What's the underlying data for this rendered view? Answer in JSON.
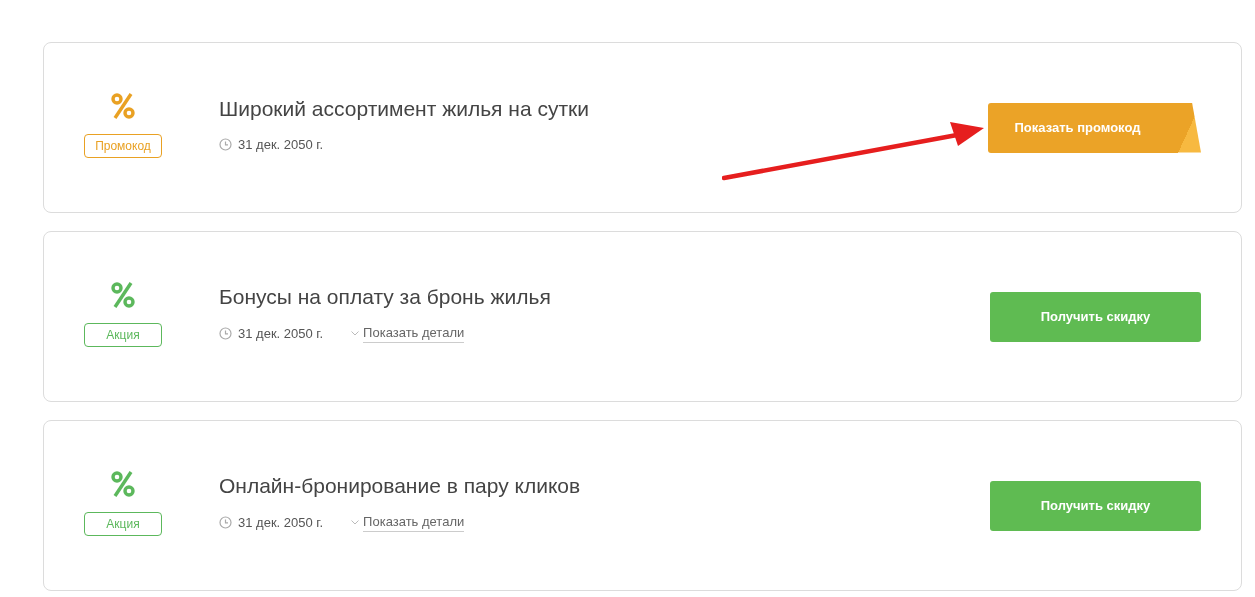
{
  "offers": [
    {
      "kind": "promo",
      "badge": "Промокод",
      "title": "Широкий ассортимент жилья на сутки",
      "date": "31 дек. 2050 г.",
      "button": "Показать промокод"
    },
    {
      "kind": "deal",
      "badge": "Акция",
      "title": "Бонусы на оплату за бронь жилья",
      "date": "31 дек. 2050 г.",
      "details": "Показать детали",
      "button": "Получить скидку"
    },
    {
      "kind": "deal",
      "badge": "Акция",
      "title": "Онлайн-бронирование в пару кликов",
      "date": "31 дек. 2050 г.",
      "details": "Показать детали",
      "button": "Получить скидку"
    }
  ]
}
